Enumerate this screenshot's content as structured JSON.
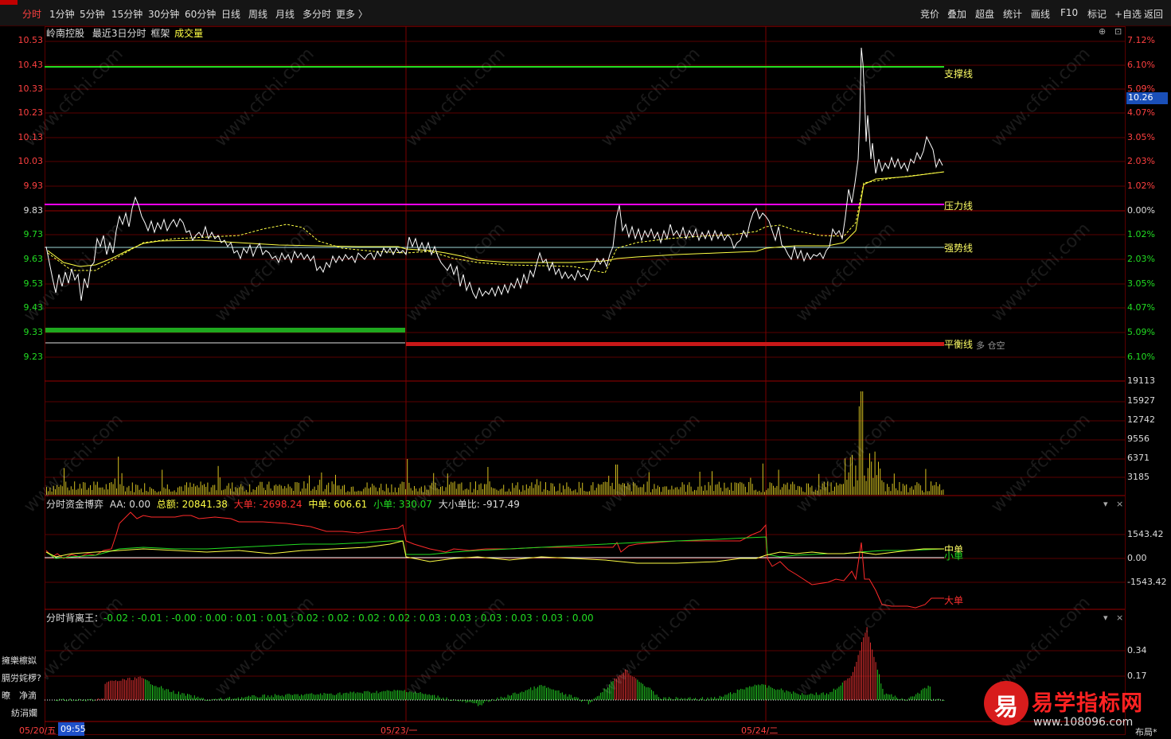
{
  "topbar": {
    "tabs": [
      "分时",
      "1分钟",
      "5分钟",
      "15分钟",
      "30分钟",
      "60分钟",
      "日线",
      "周线",
      "月线",
      "多分时",
      "更多 〉"
    ],
    "active_tab": "分时",
    "tools": [
      "竞价",
      "叠加",
      "超盘",
      "统计",
      "画线",
      "F10",
      "标记",
      "+自选",
      "返回"
    ]
  },
  "main": {
    "stock_name": "岭南控股",
    "period": "最近3日分时",
    "frame": "框架",
    "volume_label": "成交量",
    "price_ticks": [
      "10.53",
      "10.43",
      "10.33",
      "10.23",
      "10.13",
      "10.03",
      "9.93",
      "9.83",
      "9.73",
      "9.63",
      "9.53",
      "9.43",
      "9.33",
      "9.23"
    ],
    "pct_ticks": [
      "7.12%",
      "6.10%",
      "5.09%",
      "4.07%",
      "3.05%",
      "2.03%",
      "1.02%",
      "0.00%",
      "1.02%",
      "2.03%",
      "3.05%",
      "4.07%",
      "5.09%",
      "6.10%"
    ],
    "current_price": "10.26",
    "lines": {
      "support": "支撑线",
      "pressure": "压力线",
      "strong": "强势线",
      "balance": "平衡线"
    },
    "overlap_text": "多 仓空",
    "colors": {
      "support": "#22dd22",
      "pressure": "#ff00ff",
      "strong": "#a0d8d8",
      "price": "#ffffff",
      "avg": "#ffff44"
    }
  },
  "volume": {
    "ticks": [
      "19113",
      "15927",
      "12742",
      "9556",
      "6371",
      "3185"
    ]
  },
  "fund": {
    "title": "分时资金博弈",
    "aa": "AA: 0.00",
    "total": "总额: 20841.38",
    "big": "大单: -2698.24",
    "mid": "中单: 606.61",
    "small": "小单: 330.07",
    "ratio": "大小单比: -917.49",
    "ticks": [
      "1543.42",
      "0.00",
      "-1543.42"
    ],
    "line_mid": "中单",
    "line_small": "小单",
    "line_big": "大单"
  },
  "diverge": {
    "title": "分时背离王：",
    "values": "-0.02 : -0.01 : -0.00 : 0.00 : 0.01 : 0.01 : 0.02 : 0.02 : 0.02 : 0.02 : 0.03 : 0.03 : 0.03 : 0.03 : 0.03 : 0.00",
    "ticks": [
      "0.34",
      "0.17"
    ],
    "side_labels": [
      "擁樂檫姒",
      "膈労姹椤?",
      "暸",
      "净滴",
      "紡涓孄"
    ]
  },
  "xaxis": {
    "dates": [
      "05/20/五",
      "05/23/一",
      "05/24/二"
    ],
    "cursor_time": "09:55",
    "layout_btn": "布局*"
  },
  "watermark": "www.cfchi.com",
  "brand": {
    "name": "易学指标网",
    "url": "www.108096.com",
    "badge": "易"
  }
}
